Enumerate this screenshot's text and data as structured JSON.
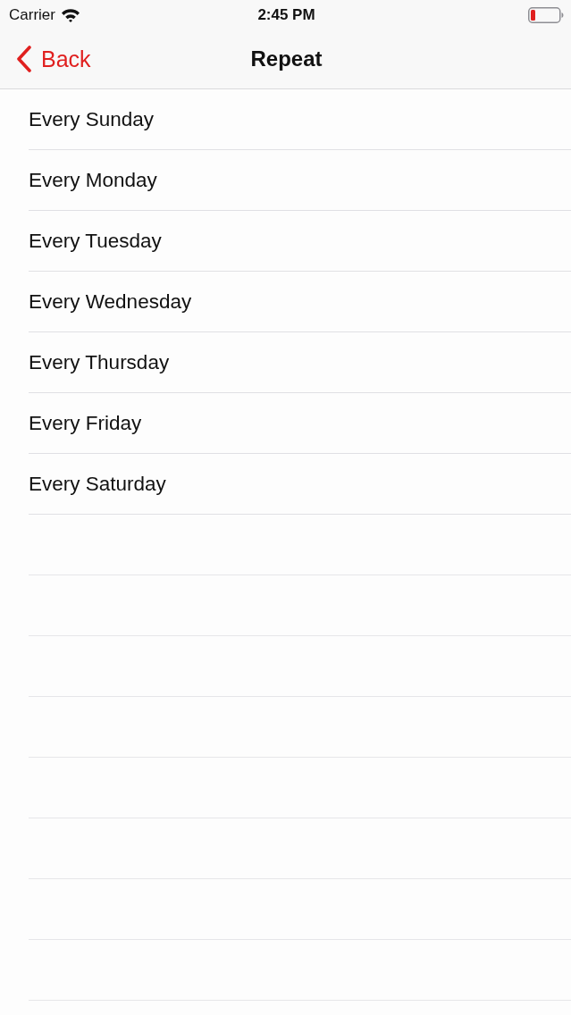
{
  "status_bar": {
    "carrier": "Carrier",
    "time": "2:45 PM"
  },
  "nav_bar": {
    "back_label": "Back",
    "title": "Repeat"
  },
  "rows": [
    {
      "label": "Every Sunday",
      "checked": false
    },
    {
      "label": "Every Monday",
      "checked": false
    },
    {
      "label": "Every Tuesday",
      "checked": false
    },
    {
      "label": "Every Wednesday",
      "checked": false
    },
    {
      "label": "Every Thursday",
      "checked": false
    },
    {
      "label": "Every Friday",
      "checked": false
    },
    {
      "label": "Every Saturday",
      "checked": false
    }
  ]
}
